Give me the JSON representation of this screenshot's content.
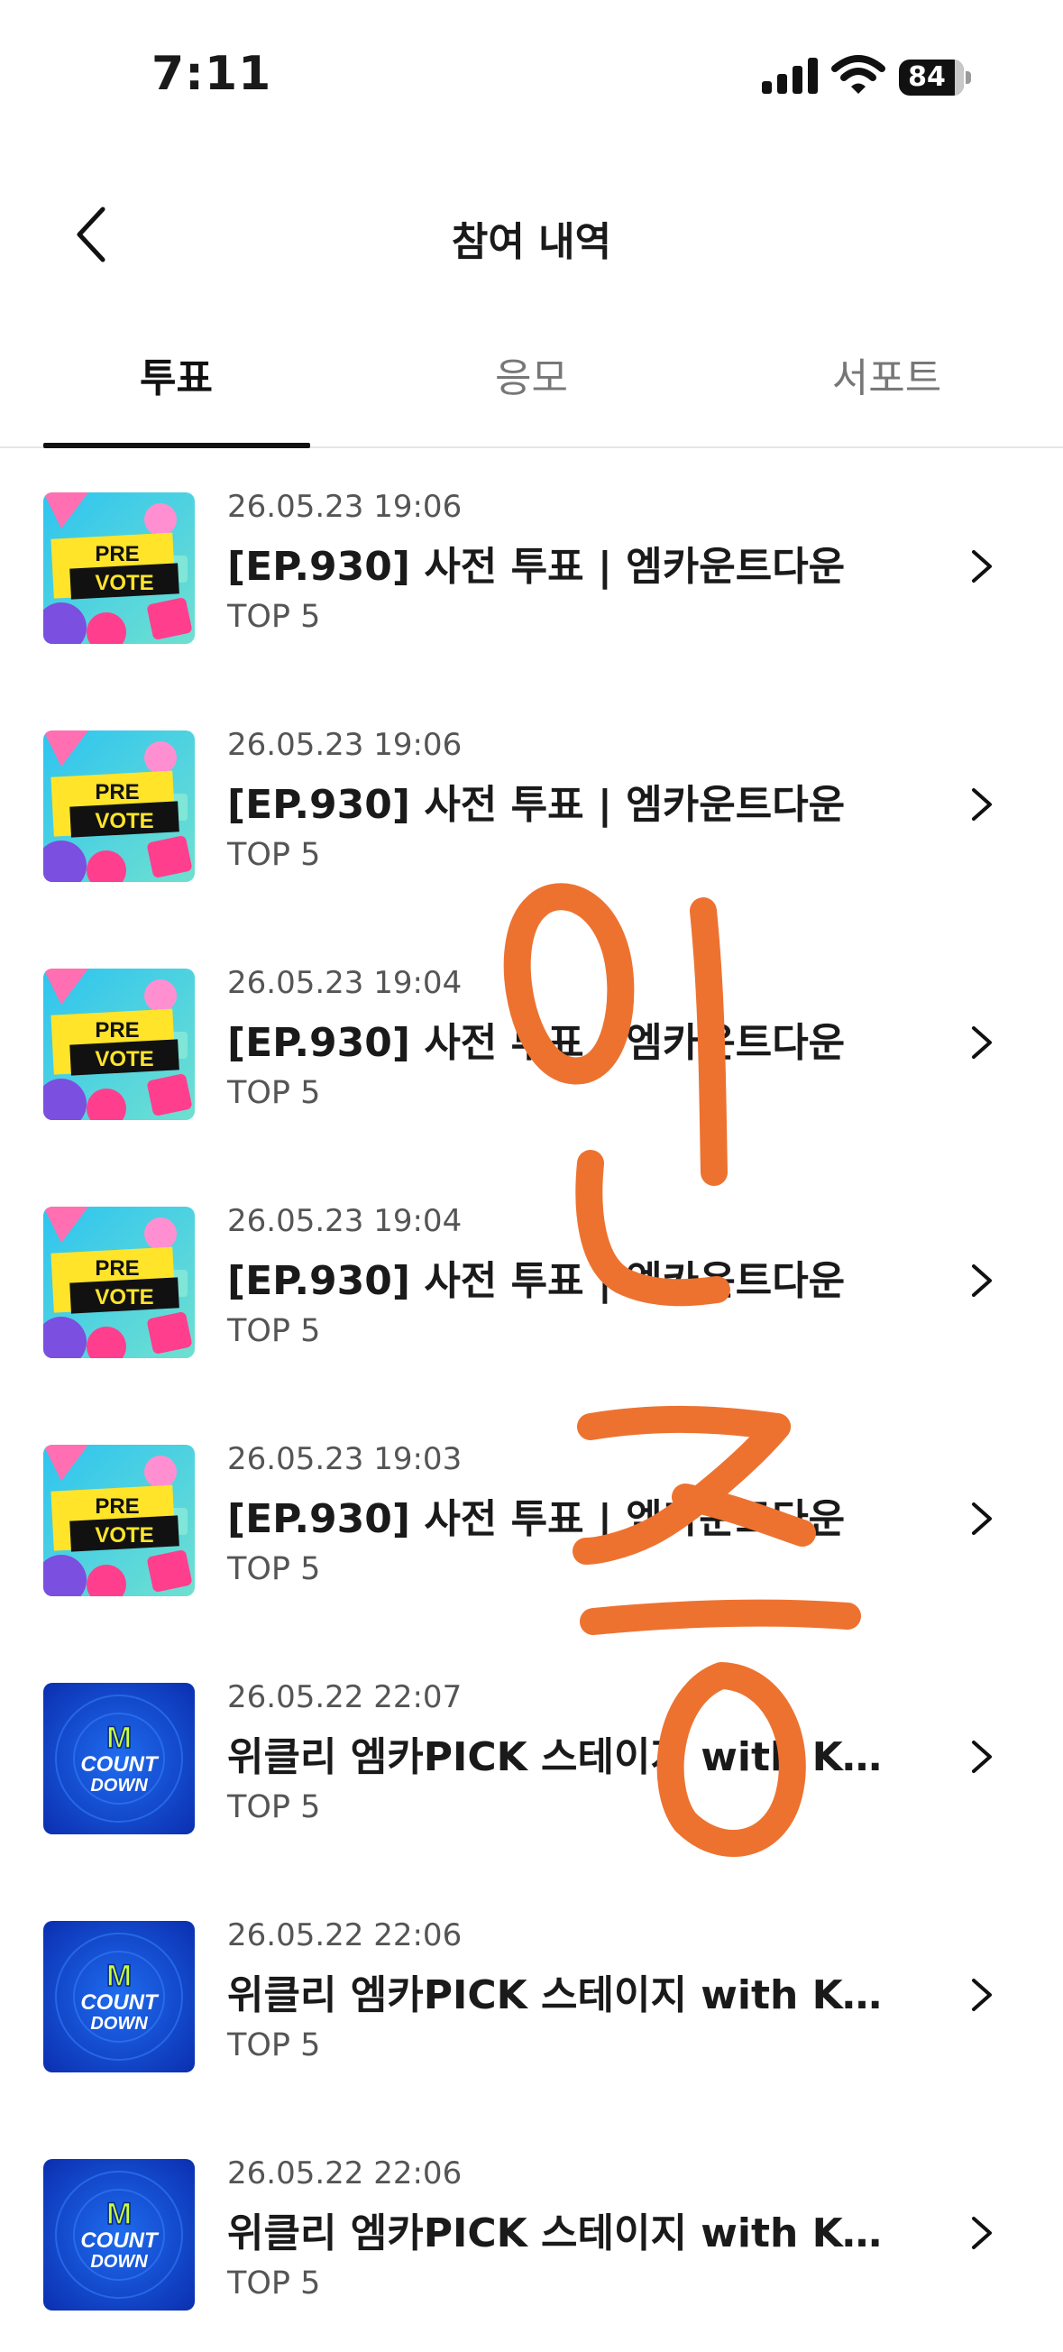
{
  "status_bar": {
    "time": "7:11",
    "battery": "84"
  },
  "header": {
    "title": "참여 내역"
  },
  "tabs": [
    {
      "label": "투표",
      "active": true
    },
    {
      "label": "응모",
      "active": false
    },
    {
      "label": "서포트",
      "active": false
    }
  ],
  "items": [
    {
      "date": "26.05.23 19:06",
      "title": "[EP.930] 사전 투표 | 엠카운트다운",
      "rank": "TOP 5",
      "thumb": "pre-vote"
    },
    {
      "date": "26.05.23 19:06",
      "title": "[EP.930] 사전 투표 | 엠카운트다운",
      "rank": "TOP 5",
      "thumb": "pre-vote"
    },
    {
      "date": "26.05.23 19:04",
      "title": "[EP.930] 사전 투표 | 엠카운트다운",
      "rank": "TOP 5",
      "thumb": "pre-vote"
    },
    {
      "date": "26.05.23 19:04",
      "title": "[EP.930] 사전 투표 | 엠카운트다운",
      "rank": "TOP 5",
      "thumb": "pre-vote"
    },
    {
      "date": "26.05.23 19:03",
      "title": "[EP.930] 사전 투표 | 엠카운트다운",
      "rank": "TOP 5",
      "thumb": "pre-vote"
    },
    {
      "date": "26.05.22 22:07",
      "title": "위클리 엠카PICK 스테이지 with KUR...",
      "rank": "TOP 5",
      "thumb": "m-countdown"
    },
    {
      "date": "26.05.22 22:06",
      "title": "위클리 엠카PICK 스테이지 with KUR...",
      "rank": "TOP 5",
      "thumb": "m-countdown"
    },
    {
      "date": "26.05.22 22:06",
      "title": "위클리 엠카PICK 스테이지 with KUR...",
      "rank": "TOP 5",
      "thumb": "m-countdown"
    }
  ],
  "thumbnails": {
    "pre_vote": {
      "line1": "PRE",
      "line2": "VOTE"
    },
    "m_countdown": {
      "logo": "M",
      "line1": "COUNT",
      "line2": "DOWN"
    }
  },
  "overlay": {
    "text": "인증",
    "color": "#ED7230"
  },
  "colors": {
    "accent": "#111111",
    "divider": "#E6E6E6",
    "muted": "#555555"
  }
}
